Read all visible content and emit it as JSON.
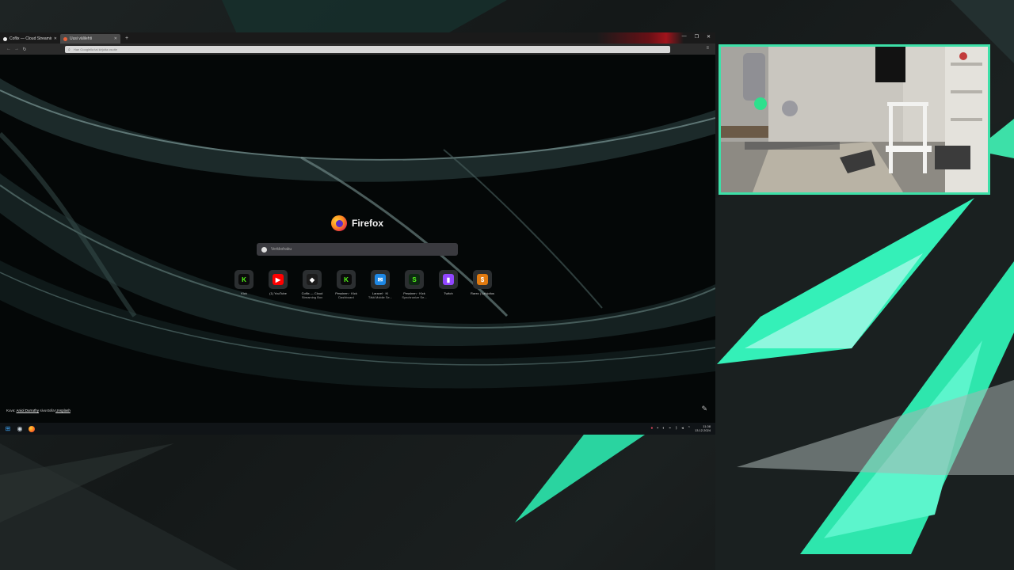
{
  "browser": {
    "tabs": [
      {
        "title": "Coflix — Cloud Streaming Box",
        "active": false,
        "favicon_color": "#f0f0f0"
      },
      {
        "title": "Uusi välilehti",
        "active": true,
        "favicon_color": "#e8613a"
      }
    ],
    "new_tab_label": "+",
    "window_controls": [
      "—",
      "❐",
      "✕"
    ],
    "url_placeholder": "Hae Googlella tai kirjoita osoite",
    "new_tab_page": {
      "brand_name": "Firefox",
      "search_placeholder": "Verkkohaku",
      "shortcuts": [
        {
          "label": "Kick",
          "sublabel": "",
          "icon_text": "K",
          "icon_color": "#53fc18",
          "icon_bg": "#0b0b0b",
          "icon": "kick-icon"
        },
        {
          "label": "(1) YouTube",
          "sublabel": "",
          "icon_text": "▶",
          "icon_color": "#ffffff",
          "icon_bg": "#ff0000",
          "icon": "youtube-icon"
        },
        {
          "label": "Coflix — Cloud",
          "sublabel": "Streaming Box",
          "icon_text": "◆",
          "icon_color": "#ffffff",
          "icon_bg": "#1b1b1b",
          "icon": "coflix-icon"
        },
        {
          "label": "Pessinen · Kick",
          "sublabel": "Dashboard",
          "icon_text": "K",
          "icon_color": "#53fc18",
          "icon_bg": "#0b0b0b",
          "icon": "kick-icon"
        },
        {
          "label": "Laravel · Ki",
          "sublabel": "Tätä Mobile Se...",
          "icon_text": "✉",
          "icon_color": "#ffffff",
          "icon_bg": "#1e88e5",
          "icon": "mail-icon"
        },
        {
          "label": "Pessinen · Kick",
          "sublabel": "Synchronize Se...",
          "icon_text": "S",
          "icon_color": "#53fc18",
          "icon_bg": "#0e2a12",
          "icon": "streamlabs-icon"
        },
        {
          "label": "Twitch",
          "sublabel": "",
          "icon_text": "▮",
          "icon_color": "#ffffff",
          "icon_bg": "#9146ff",
          "icon": "twitch-icon"
        },
        {
          "label": "Rarez | Lahjoitus",
          "sublabel": "",
          "icon_text": "$",
          "icon_color": "#ffffff",
          "icon_bg": "#e07a10",
          "icon": "donation-icon"
        }
      ],
      "credit_prefix": "Kuva:",
      "credit_author": "Aniol Durruthy",
      "credit_middle": "sivustolla",
      "credit_site": "Unsplash"
    }
  },
  "taskbar": {
    "start_icon": "windows-start-icon",
    "pinned": [
      "steam-icon",
      "firefox-icon"
    ],
    "clock_time": "11.08",
    "clock_date": "13.12.2024"
  },
  "webcam": {
    "label": ""
  }
}
